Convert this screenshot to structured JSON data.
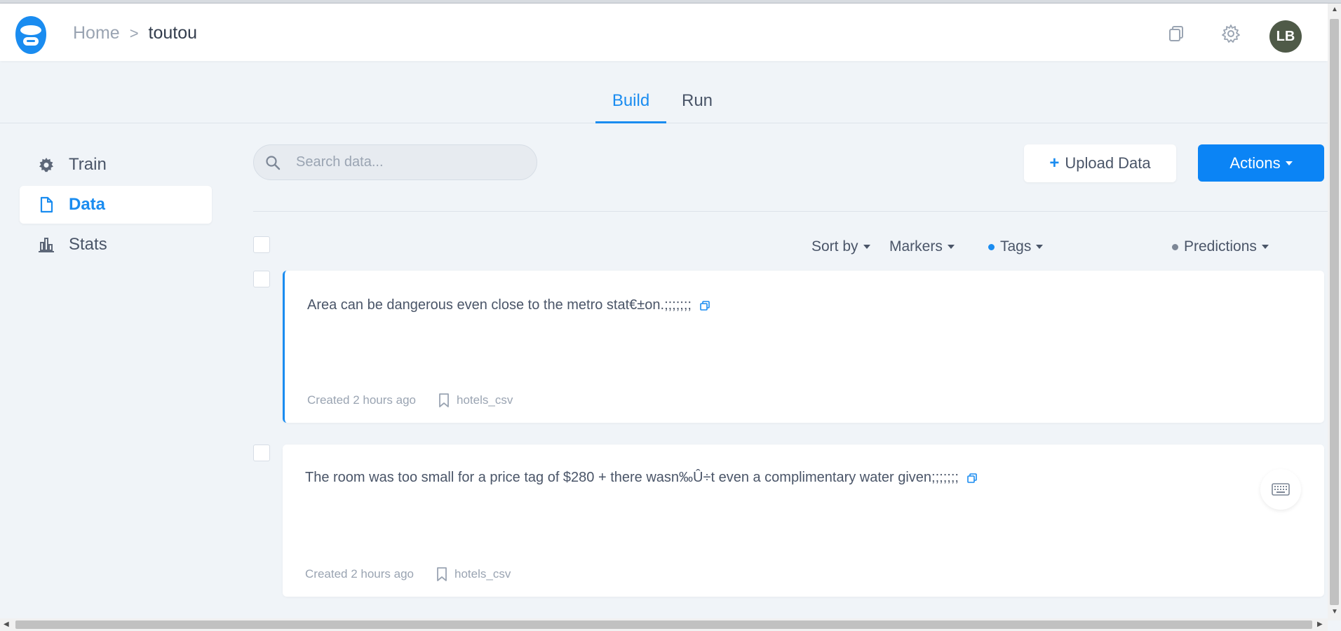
{
  "breadcrumb": {
    "home": "Home",
    "separator": ">",
    "current": "toutou"
  },
  "header": {
    "avatar_initials": "LB",
    "icons": [
      "copy-icon",
      "gear-icon"
    ]
  },
  "tabs": [
    {
      "label": "Build",
      "active": true
    },
    {
      "label": "Run",
      "active": false
    }
  ],
  "sidebar": {
    "items": [
      {
        "label": "Train",
        "icon": "gear-icon",
        "active": false
      },
      {
        "label": "Data",
        "icon": "document-icon",
        "active": true
      },
      {
        "label": "Stats",
        "icon": "bar-chart-icon",
        "active": false
      }
    ]
  },
  "search": {
    "placeholder": "Search data..."
  },
  "toolbar": {
    "upload_label": "Upload Data",
    "upload_plus": "+",
    "actions_label": "Actions"
  },
  "filters": {
    "sort_by": "Sort by",
    "markers": "Markers",
    "tags": "Tags",
    "predictions": "Predictions"
  },
  "records": [
    {
      "text": "Area can be dangerous even close to the metro stat€±on.;;;;;;;",
      "created": "Created 2 hours ago",
      "source": "hotels_csv",
      "selected": true
    },
    {
      "text": "The room was too small for a price tag of $280 + there wasn‰Û÷t even a complimentary water given;;;;;;;",
      "created": "Created 2 hours ago",
      "source": "hotels_csv",
      "selected": false
    }
  ],
  "colors": {
    "accent": "#1a8cf0",
    "primary_button": "#0b84f5",
    "background": "#f0f4f8",
    "avatar": "#4f5a48"
  }
}
